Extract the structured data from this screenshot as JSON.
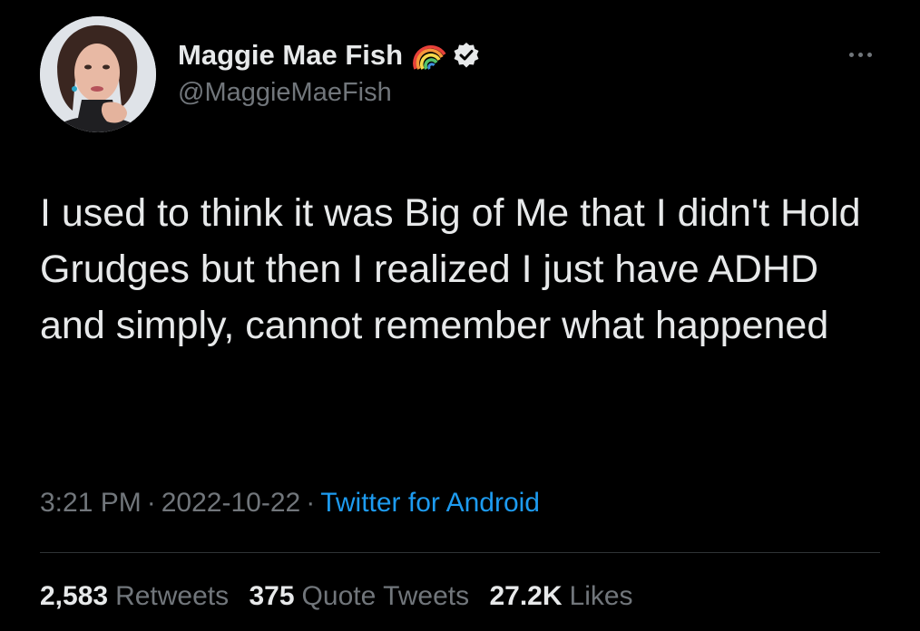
{
  "tweet": {
    "author": {
      "display_name": "Maggie Mae Fish",
      "handle": "@MaggieMaeFish",
      "badges": [
        "rainbow-icon",
        "verified-icon"
      ]
    },
    "text": "I used to think it was Big of Me that I didn't Hold Grudges but then I realized I just have ADHD and simply, cannot remember what happened",
    "time": "3:21 PM",
    "date": "2022-10-22",
    "source": "Twitter for Android",
    "separator": "·",
    "stats": {
      "retweets": {
        "count": "2,583",
        "label": "Retweets"
      },
      "quote_tweets": {
        "count": "375",
        "label": "Quote Tweets"
      },
      "likes": {
        "count": "27.2K",
        "label": "Likes"
      }
    }
  },
  "colors": {
    "background": "#000000",
    "primary_text": "#e7e9ea",
    "secondary_text": "#71767b",
    "link": "#1d9bf0",
    "divider": "#2f3336"
  }
}
